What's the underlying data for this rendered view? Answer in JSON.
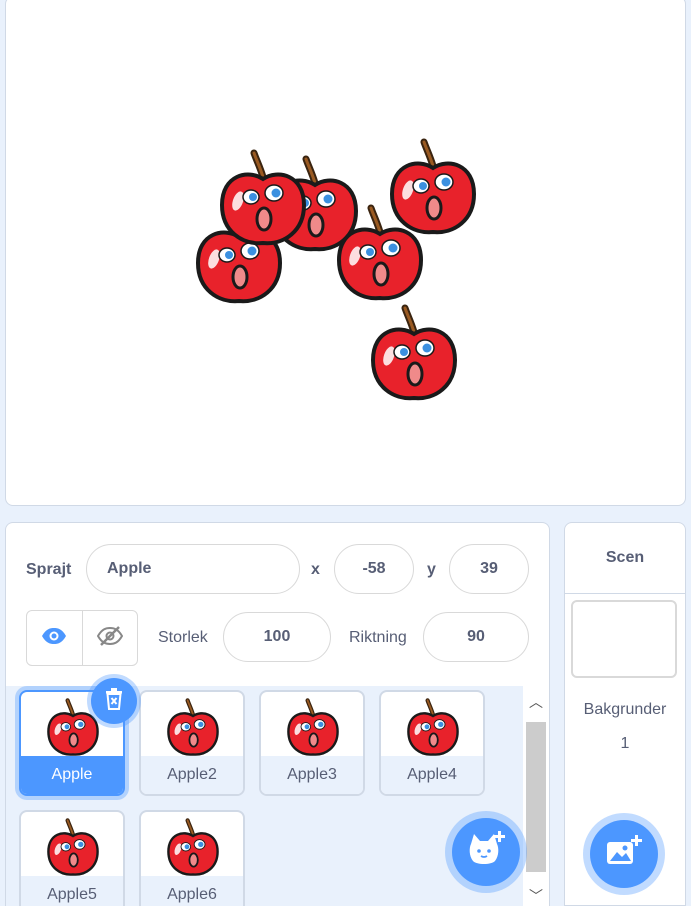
{
  "stage": {
    "sprites": [
      "Apple",
      "Apple2",
      "Apple3",
      "Apple4",
      "Apple5",
      "Apple6"
    ]
  },
  "sprite_info": {
    "sprite_label": "Sprajt",
    "sprite_name": "Apple",
    "x_label": "x",
    "x_value": "-58",
    "y_label": "y",
    "y_value": "39",
    "size_label": "Storlek",
    "size_value": "100",
    "direction_label": "Riktning",
    "direction_value": "90",
    "show_icon": "eye-icon",
    "hide_icon": "eye-slash-icon"
  },
  "sprite_list": {
    "selected": "Apple",
    "items": [
      "Apple",
      "Apple2",
      "Apple3",
      "Apple4",
      "Apple5",
      "Apple6"
    ]
  },
  "scene": {
    "title": "Scen",
    "backdrops_label": "Bakgrunder",
    "backdrops_count": "1"
  },
  "colors": {
    "accent": "#4c97ff",
    "text": "#575e75",
    "apple_red": "#e8222b"
  }
}
